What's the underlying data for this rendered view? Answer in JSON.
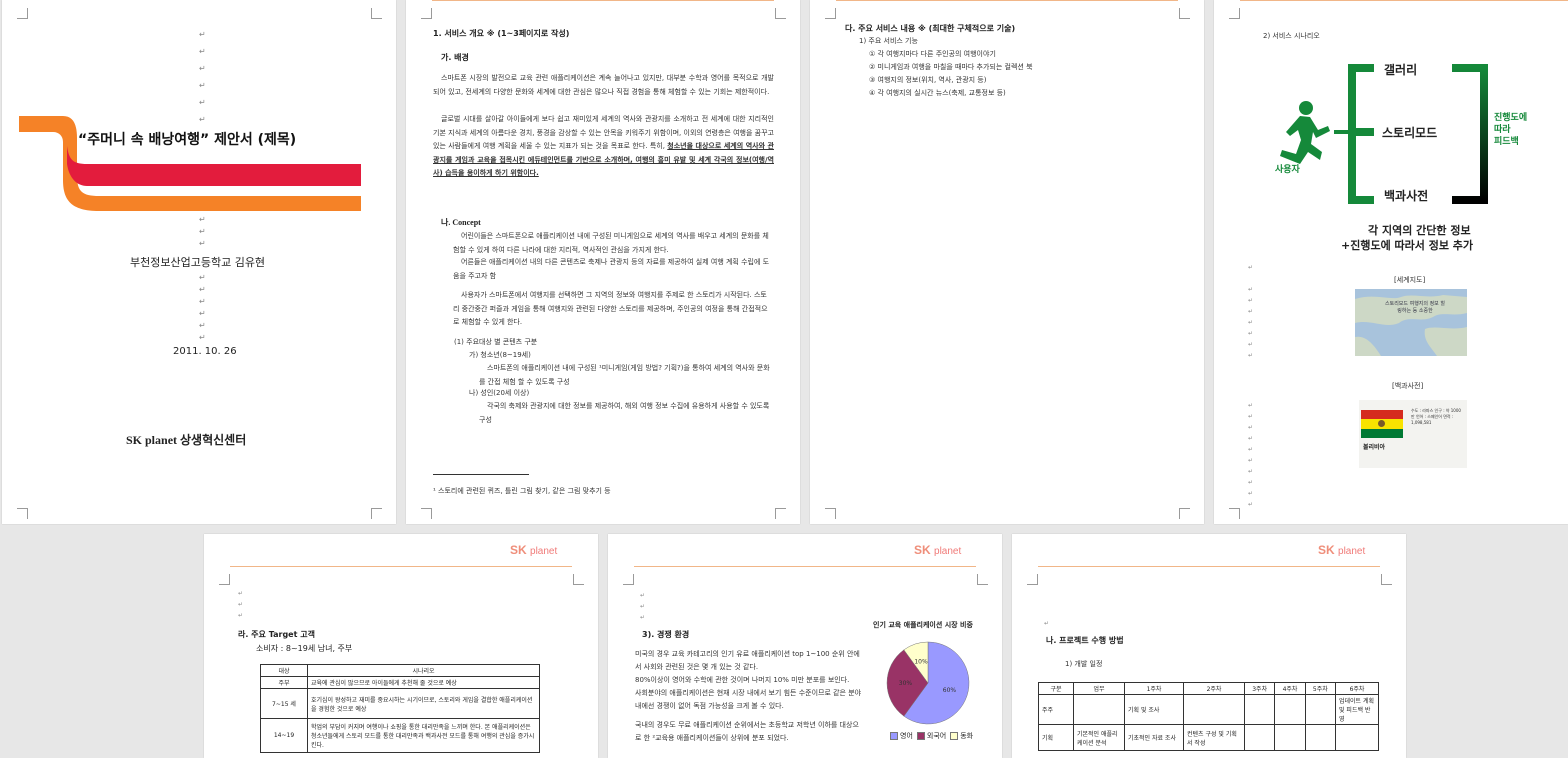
{
  "page1": {
    "title": "“주머니 속 배낭여행” 제안서 (제목)",
    "school": "부천정보산업고등학교 김유현",
    "date": "2011. 10. 26",
    "org": "SK planet 상생혁신센터"
  },
  "page2": {
    "section1": "1. 서비스 개요 ※ (1~3페이지로 작성)",
    "sub_a": "가. 배경",
    "bg_p1": "스마트폰 시장의 발전으로 교육 관련 애플리케이션은 계속 늘어나고 있지만, 대부분 수학과 영어를 목적으로 개발되어 있고, 전세계의 다양한 문화와 세계에 대한 관심은 많으나 직접 경험을 통해 체험할 수 있는 기회는 제한적이다.",
    "bg_p2": "글로벌 시대를 살아갈 아이들에게 보다 쉽고 재미있게 세계의 역사와 관광지를 소개하고 전 세계에 대한 지리적인 기본 지식과 세계의 아름다운 경치, 풍경을 감상할 수 있는 안목을 키워주기 위함이며, 이외의 연령층은 여행을 꿈꾸고 있는 사람들에게 여행 계획을 세울 수 있는 지표가 되는 것을 목표로 한다. 특히,",
    "bg_p2_u": "청소년을 대상으로 세계의 역사와 관광지를 게임과 교육을 접목시킨 에듀테인먼트를 기반으로 소개하며, 여행의 흥미 유발 및 세계 각국의 정보(여행/역사) 습득을 용이하게 하기 위함이다.",
    "sub_b": "나. Concept",
    "concept_p1": "어린이들은 스마트폰으로 애플리케이션 내에 구성된 미니게임으로 세계의 역사를 배우고 세계의 문화를 체험할 수 있게 하여 다른 나라에 대한 지리적, 역사적인 관심을 가지게 한다.",
    "concept_p2": "어른들은 애플리케이션 내의 다른 콘텐츠로 축제나 관광지 등의 자료를 제공하여 실제 여행 계획 수립에 도움을 주고자 함",
    "concept_p3": "사용자가 스마트폰에서 여행지를 선택하면 그 지역의 정보와 여행지를 주제로 한 스토리가 시작된다. 스토리 중간중간 퍼즐과 게임을 통해 여행지와 관련된 다양한 스토리를 제공하며, 주인공의 여정을 통해 간접적으로 체험할 수 있게 한다.",
    "target_title": "(1) 주요대상 별 콘텐츠 구분",
    "target_a": "가) 청소년(8~19세)",
    "target_a_desc": "스마트폰의 애플리케이션 내에 구성된 ¹미니게임(게임 방법? 기획?)을 통하여 세계의 역사와 문화를 간접 체험 할 수 있도록 구성",
    "target_b": "나) 성인(20세 이상)",
    "target_b_desc": "각국의 축제와 관광지에 대한 정보를 제공하여, 해외 여행 정보 수집에 유용하게 사용할 수 있도록 구성",
    "footnote": "¹ 스토리에 관련된 퀴즈, 틀린 그림 찾기, 같은 그림 맞추기 등"
  },
  "page3": {
    "section": "다. 주요 서비스 내용 ※ (최대한 구체적으로 기술)",
    "sub": "1) 주요 서비스 기능",
    "items": [
      "① 각 여행지마다 다른 주인공의 여행이야기",
      "② 미니게임과 여행을 마칠을 때마다 추가되는 컬렉션 북",
      "③ 여행지의 정보(위치, 역사, 관광지 등)",
      "④ 각 여행지의 실시간 뉴스(축제, 교통정보 등)"
    ]
  },
  "page4": {
    "heading": "2) 서비스 시나리오",
    "gallery": "갤러리",
    "story": "스토리모드",
    "encyclopedia": "백과사전",
    "user": "사용자",
    "feedback": "진행도에\n따라\n피드백",
    "caption1": "각 지역의 간단한 정보",
    "caption2": "+진행도에 따라서 정보 추가",
    "map_label": "[세계지도]",
    "map_note": "스토리모드 여행지의 정보 힐링하는 등 소중한",
    "dict_label": "[백과사전]",
    "flag_country": "볼리비아",
    "dict_note": "수도 : 라파스 인구 : 약 1000만 언어 : 스페인어 면적 : 1,098,581"
  },
  "page5": {
    "logo_sk": "SK",
    "logo_planet": "planet",
    "section": "라. 주요 Target 고객",
    "consumer": "소비자 : 8~19세 남녀, 주부",
    "table_headers": [
      "대상",
      "시나리오"
    ],
    "table_rows": [
      [
        "주부",
        "교육에 관심이 많으므로 아이들에게 추천해 줄 것으로 예상"
      ],
      [
        "7~15 세",
        "호기심이 왕성하고 재미를 중요시하는 시기이므로, 스토리와 게임을 결합한 애플리케이션을 경험한 것으로 예상"
      ],
      [
        "14~19",
        "학업의 부담이 커지며 여행이나 쇼핑을 통한 대리만족을 느끼며 한다. 본 애플리케이션은 청소년들에게 스토리 모드를 통한 대리만족과 백과사전 모드를 통해 여행의 관심을 증가시킨다."
      ]
    ]
  },
  "page6": {
    "logo_sk": "SK",
    "logo_planet": "planet",
    "section": "3). 경쟁 환경",
    "paragraphs": [
      "미국의 경우 교육 카테고리의 인기 유료 애플리케이션 top 1~100 순위 안에서 사회와 관련된 것은 몇 개 있는 것 같다.",
      "80%이상이 영어와 수학에 관한 것이며 나머지 10% 미만 분포를 보인다.",
      "사회분야의 애플리케이션은 현재 시장 내에서 보기 힘든 수준이므로 같은 분야 내에선 경쟁이 없어 독점 가능성을 크게 볼 수 있다.",
      "국내의 경우도 무료 애플리케이션 순위에서는 초등학교 저학년 이하를 대상으로 한 ²교육용 애플리케이션들이 상위에 분포 되었다."
    ],
    "chart_data": {
      "type": "pie",
      "title": "인기 교육 애플리케이션 시장 비중",
      "categories": [
        "영어",
        "외국어",
        "동화"
      ],
      "values": [
        60,
        30,
        10
      ],
      "labels": [
        "60%",
        "30%",
        "10%"
      ],
      "colors": [
        "#9999ff",
        "#993366",
        "#ffffcc"
      ],
      "legend": "bottom"
    }
  },
  "page7": {
    "logo_sk": "SK",
    "logo_planet": "planet",
    "section": "나. 프로젝트 수행 방법",
    "sub": "1) 개발 일정",
    "table": [
      [
        "구분",
        "업무",
        "1주차",
        "2주차",
        "3주차",
        "4주차",
        "5주차",
        "6주차"
      ],
      [
        "",
        "",
        "기획 및 조사",
        "",
        "",
        "",
        "",
        "업데이트 계획 및 피드백 반영"
      ],
      [
        "기획",
        "기본적인 애플리케이션 분석",
        "기초적인 자료 조사",
        "컨텐츠 구성 및 기획서 작성",
        "",
        "",
        "",
        ""
      ]
    ]
  }
}
